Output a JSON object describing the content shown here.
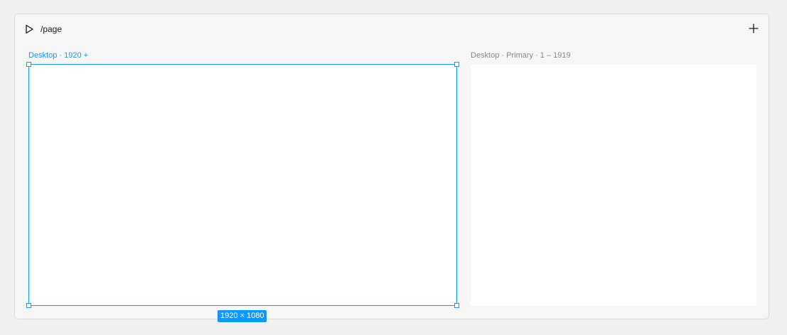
{
  "header": {
    "path": "/page",
    "play_icon": "play-icon",
    "add_icon": "plus-icon"
  },
  "frames": [
    {
      "label": "Desktop · 1920 +",
      "selected": true,
      "size_label": "1920 × 1080"
    },
    {
      "label": "Desktop · Primary · 1 – 1919",
      "selected": false
    }
  ],
  "colors": {
    "selection": "#0d99ff",
    "canvas": "#f6f6f6",
    "frame_fill": "#ffffff"
  }
}
